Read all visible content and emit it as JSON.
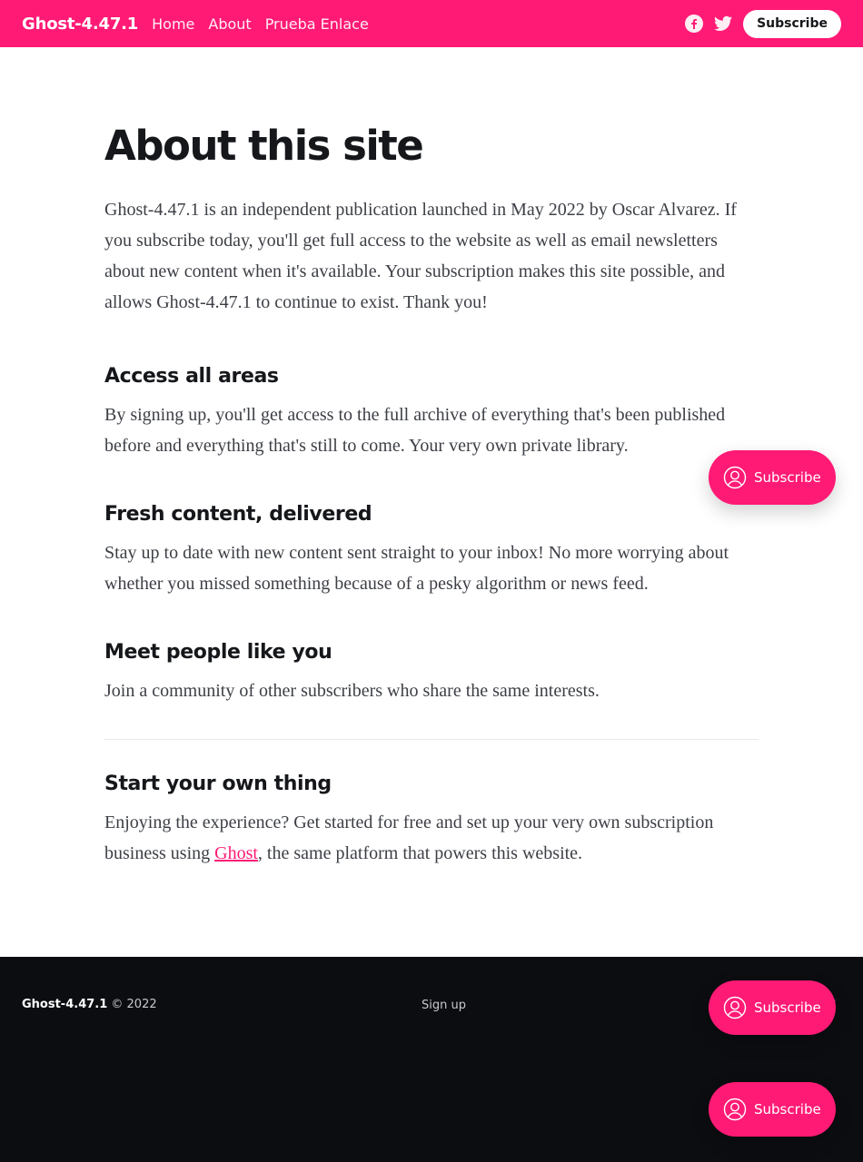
{
  "header": {
    "brand": "Ghost-4.47.1",
    "nav": [
      {
        "label": "Home"
      },
      {
        "label": "About"
      },
      {
        "label": "Prueba Enlace"
      }
    ],
    "social": [
      "facebook-icon",
      "twitter-icon"
    ],
    "subscribe_label": "Subscribe",
    "accent_color": "#ff1a75"
  },
  "main": {
    "title": "About this site",
    "intro": "Ghost-4.47.1 is an independent publication launched in May 2022 by Oscar Alvarez. If you subscribe today, you'll get full access to the website as well as email newsletters about new content when it's available. Your subscription makes this site possible, and allows Ghost-4.47.1 to continue to exist. Thank you!",
    "sections": [
      {
        "heading": "Access all areas",
        "body": "By signing up, you'll get access to the full archive of everything that's been published before and everything that's still to come. Your very own private library."
      },
      {
        "heading": "Fresh content, delivered",
        "body": "Stay up to date with new content sent straight to your inbox! No more worrying about whether you missed something because of a pesky algorithm or news feed."
      },
      {
        "heading": "Meet people like you",
        "body": "Join a community of other subscribers who share the same interests."
      }
    ],
    "own_thing": {
      "heading": "Start your own thing",
      "body_before": "Enjoying the experience? Get started for free and set up your very own subscription business using ",
      "link": "Ghost",
      "body_after": ", the same platform that powers this website."
    }
  },
  "footer": {
    "brand": "Ghost-4.47.1",
    "copyright": "© 2022",
    "signup": "Sign up",
    "powered_partial": "st"
  },
  "portal": {
    "label": "Subscribe"
  }
}
